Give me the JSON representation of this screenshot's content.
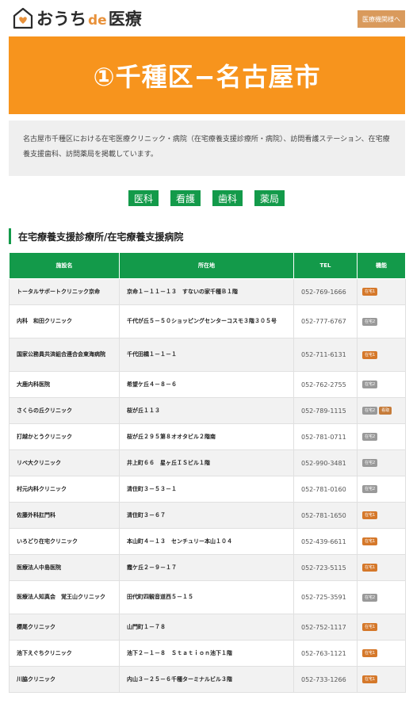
{
  "header": {
    "logo_prefix": "おうち",
    "logo_de": "de",
    "logo_suffix": "医療",
    "button_label": "医療機関様へ"
  },
  "banner": {
    "title": "①千種区−名古屋市"
  },
  "intro": {
    "text": "名古屋市千種区における在宅医療クリニック・病院（在宅療養支援診療所・病院）、訪問看護ステーション、在宅療養支援歯科、訪問薬局を掲載しています。"
  },
  "tabs": [
    "医科",
    "看護",
    "歯科",
    "薬局"
  ],
  "section": {
    "heading": "在宅療養支援診療所/在宅療養支援病院"
  },
  "table": {
    "headers": [
      "施設名",
      "所在地",
      "TEL",
      "機能"
    ],
    "rows": [
      {
        "name": "トータルサポートクリニック京命",
        "address": "京命１－１１－１３　すないの家千種Ｂ１階",
        "tel": "052-769-1666",
        "badges": [
          "b1"
        ]
      },
      {
        "name": "内科　和田クリニック",
        "address": "千代が丘５－５０ショッピングセンターコスモ３階３０５号",
        "tel": "052-777-6767",
        "badges": [
          "b2"
        ]
      },
      {
        "name": "国家公務員共済組合連合会東海病院",
        "address": "千代田橋１－１－１",
        "tel": "052-711-6131",
        "badges": [
          "b1"
        ]
      },
      {
        "name": "大鹿内科医院",
        "address": "希望ケ丘４－８－６",
        "tel": "052-762-2755",
        "badges": [
          "b2"
        ]
      },
      {
        "name": "さくらの丘クリニック",
        "address": "桜が丘１１３",
        "tel": "052-789-1115",
        "badges": [
          "b2",
          "kan"
        ]
      },
      {
        "name": "打越かとうクリニック",
        "address": "桜が丘２９５第８オオタビル２階南",
        "tel": "052-781-0711",
        "badges": [
          "b2"
        ]
      },
      {
        "name": "リベ大クリニック",
        "address": "井上町６６　星ヶ丘ＩＳビル１階",
        "tel": "052-990-3481",
        "badges": [
          "b2"
        ]
      },
      {
        "name": "村元内科クリニック",
        "address": "清住町３－５３－１",
        "tel": "052-781-0160",
        "badges": [
          "b2"
        ]
      },
      {
        "name": "佐藤外科肛門科",
        "address": "清住町３－６７",
        "tel": "052-781-1650",
        "badges": [
          "b1"
        ]
      },
      {
        "name": "いろどり在宅クリニック",
        "address": "本山町４－１３　センチュリー本山１０４",
        "tel": "052-439-6611",
        "badges": [
          "b1"
        ]
      },
      {
        "name": "医療法人中島医院",
        "address": "霞ケ丘２－９－１７",
        "tel": "052-723-5115",
        "badges": [
          "b1"
        ]
      },
      {
        "name": "医療法人知真会　覚王山クリニック",
        "address": "田代町四観音道西５－１５",
        "tel": "052-725-3591",
        "badges": [
          "b2"
        ]
      },
      {
        "name": "櫻尾クリニック",
        "address": "山門町１－７８",
        "tel": "052-752-1117",
        "badges": [
          "b1"
        ]
      },
      {
        "name": "池下えぐちクリニック",
        "address": "池下２－１－８　Ｓｔａｔｉｏｎ池下１階",
        "tel": "052-763-1121",
        "badges": [
          "b1"
        ]
      },
      {
        "name": "川脇クリニック",
        "address": "内山３－２５－６千種ターミナルビル３階",
        "tel": "052-733-1266",
        "badges": [
          "b1"
        ]
      }
    ]
  },
  "badge_labels": {
    "b1": "在宅1",
    "b2": "在宅2",
    "kan": "看取"
  },
  "colors": {
    "brand_green": "#139a4a",
    "banner_orange": "#f7941d",
    "header_btn": "#d99a5c"
  }
}
